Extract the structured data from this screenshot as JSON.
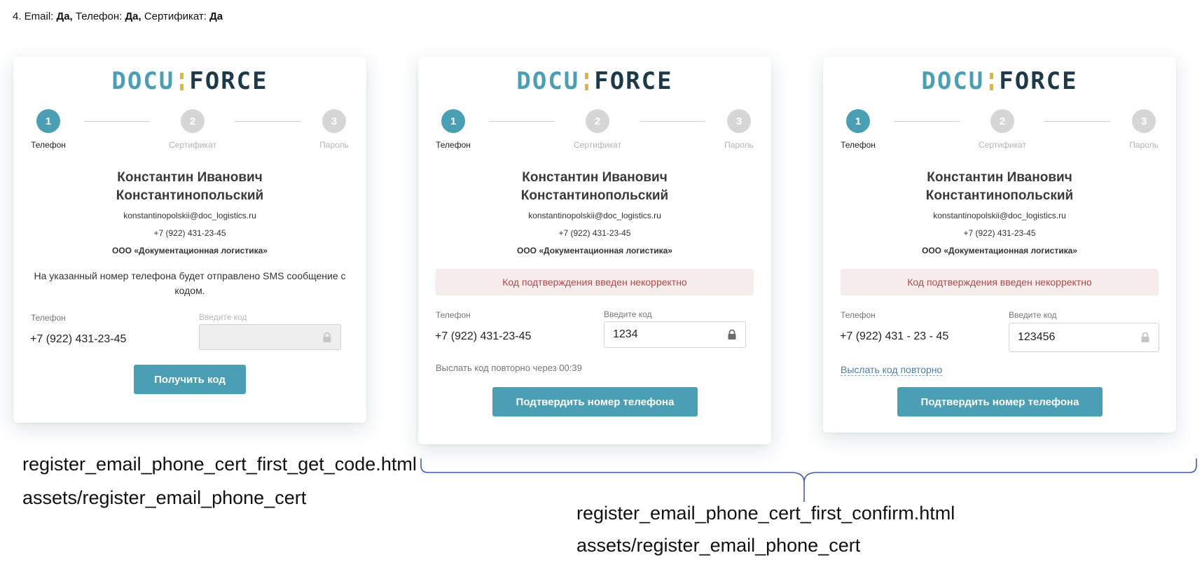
{
  "heading": {
    "prefix": "4. Email: ",
    "email_value": "Да,",
    "phone_label": " Телефон: ",
    "phone_value": "Да,",
    "cert_label": " Сертификат: ",
    "cert_value": "Да"
  },
  "logo": {
    "part1": "DOCU",
    "part2": "FORCE"
  },
  "steps": [
    {
      "number": "1",
      "label": "Телефон"
    },
    {
      "number": "2",
      "label": "Сертификат"
    },
    {
      "number": "3",
      "label": "Пароль"
    }
  ],
  "user": {
    "first_line": "Константин Иванович",
    "second_line": "Константинопольский",
    "email": "konstantinopolskii@doc_logistics.ru",
    "phone": "+7 (922) 431-23-45",
    "company": "ООО «Документационная логистика»"
  },
  "card1": {
    "description": "На указанный номер телефона будет отправлено SMS сообщение с кодом.",
    "phone_label": "Телефон",
    "phone_value": "+7 (922) 431-23-45",
    "code_label": "Введите код",
    "code_value": "",
    "button": "Получить код"
  },
  "card2": {
    "error": "Код подтверждения введен некорректно",
    "phone_label": "Телефон",
    "phone_value": "+7 (922) 431-23-45",
    "code_label": "Введите код",
    "code_value": "1234",
    "resend_timer": "Выслать код повторно через 00:39",
    "button": "Подтвердить номер телефона"
  },
  "card3": {
    "error": "Код подтверждения введен некорректно",
    "phone_label": "Телефон",
    "phone_value": "+7 (922) 431 - 23 - 45",
    "code_label": "Введите код",
    "code_value": "123456",
    "resend_link": "Выслать код повторно",
    "button": "Подтвердить номер телефона"
  },
  "captions": {
    "left_file": "register_email_phone_cert_first_get_code.html",
    "left_assets": "assets/register_email_phone_cert",
    "right_file": "register_email_phone_cert_first_confirm.html",
    "right_assets": "assets/register_email_phone_cert"
  },
  "colors": {
    "accent": "#4a9fb5",
    "logo_dark": "#1d3a4a",
    "logo_separator": "#e3b341",
    "error_bg": "#f7ecec",
    "error_text": "#b04a4a",
    "link": "#4a7fa8",
    "bracket": "#3f5fa8"
  }
}
